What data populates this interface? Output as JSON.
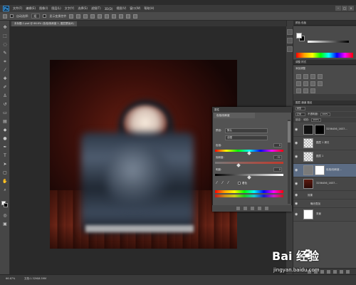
{
  "app": {
    "logo": "Ps",
    "window_title": "Photoshop"
  },
  "menu": [
    "文件(F)",
    "编辑(E)",
    "图像(I)",
    "图层(L)",
    "文字(Y)",
    "选择(S)",
    "滤镜(T)",
    "3D(D)",
    "视图(V)",
    "窗口(W)",
    "帮助(H)"
  ],
  "options_bar": {
    "auto_select_label": "自动选择:",
    "auto_select_value": "组",
    "show_transform_label": "显示变换控件"
  },
  "document": {
    "tab_title": "未标题-1.psd @ 66.6% (色相/饱和度 1, 图层蒙版/8)",
    "zoom": "66.67%",
    "info": "文档:1.32M/6.59M"
  },
  "color_panel": {
    "title": "颜色 色板"
  },
  "adjustments_panel": {
    "title": "调整 样式",
    "subtitle": "添加调整"
  },
  "layers_panel": {
    "title": "图层 通道 路径",
    "kind_filter": "类型",
    "blend_mode": "正常",
    "opacity_label": "不透明度:",
    "opacity": "100%",
    "lock_label": "锁定:",
    "fill_label": "填充:",
    "fill": "100%",
    "layers": [
      {
        "name": "3256456_1637...",
        "selected": false,
        "has_mask": true
      },
      {
        "name": "图层 1 拷贝",
        "selected": false,
        "has_mask": false
      },
      {
        "name": "图层 1",
        "selected": false,
        "has_mask": false
      },
      {
        "name": "色相/饱和度...",
        "selected": true,
        "has_mask": true
      },
      {
        "name": "3256456_1637...",
        "selected": false,
        "has_mask": false
      },
      {
        "name": "效果",
        "selected": false,
        "has_mask": false
      },
      {
        "name": "曝光叠加",
        "selected": false,
        "has_mask": false
      },
      {
        "name": "背景",
        "selected": false,
        "has_mask": false
      }
    ]
  },
  "properties_panel": {
    "title": "属性",
    "tab": "色相/饱和度",
    "preset_label": "预设:",
    "preset_value": "默认",
    "channel_value": "全图",
    "hue_label": "色相:",
    "hue_value": "0",
    "saturation_label": "饱和度:",
    "saturation_value": "-31",
    "lightness_label": "明度:",
    "lightness_value": "0",
    "colorize_label": "着色"
  },
  "watermark": {
    "logo": "Bai  经验",
    "url": "jingyan.baidu.com"
  },
  "colors": {
    "canvas_bg": "#2a2a2a",
    "selection": "#5c6c84",
    "panel": "#4a4a4a"
  }
}
